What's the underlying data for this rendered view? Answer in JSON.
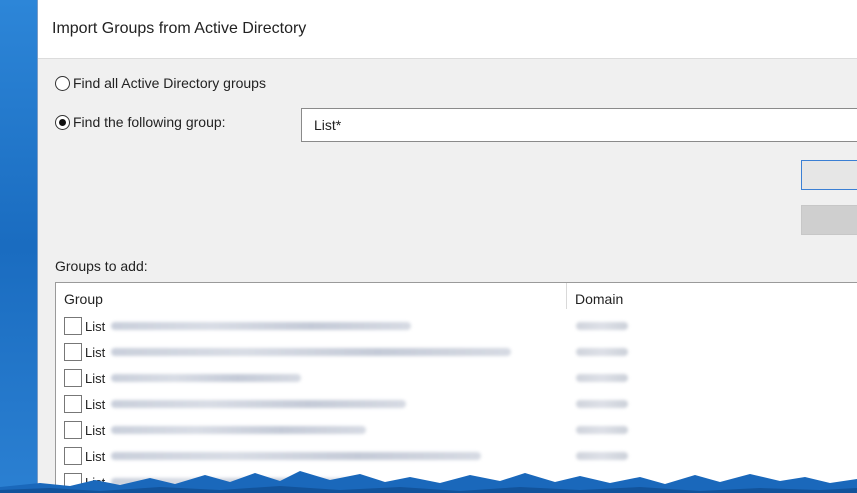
{
  "dialog": {
    "title": "Import Groups from Active Directory",
    "option_all_label": "Find all Active Directory groups",
    "option_find_label": "Find the following group:",
    "option_find_checked": true,
    "search_value": "List*",
    "groups_to_add_label": "Groups to add:",
    "columns": {
      "group": "Group",
      "domain": "Domain"
    },
    "rows": [
      {
        "prefix": "List"
      },
      {
        "prefix": "List"
      },
      {
        "prefix": "List"
      },
      {
        "prefix": "List"
      },
      {
        "prefix": "List"
      },
      {
        "prefix": "List"
      },
      {
        "prefix": "List"
      }
    ]
  },
  "colors": {
    "desktop": "#1b6fc4",
    "dialog_bg": "#f0f0f0",
    "focus_border": "#3a7fd4"
  }
}
